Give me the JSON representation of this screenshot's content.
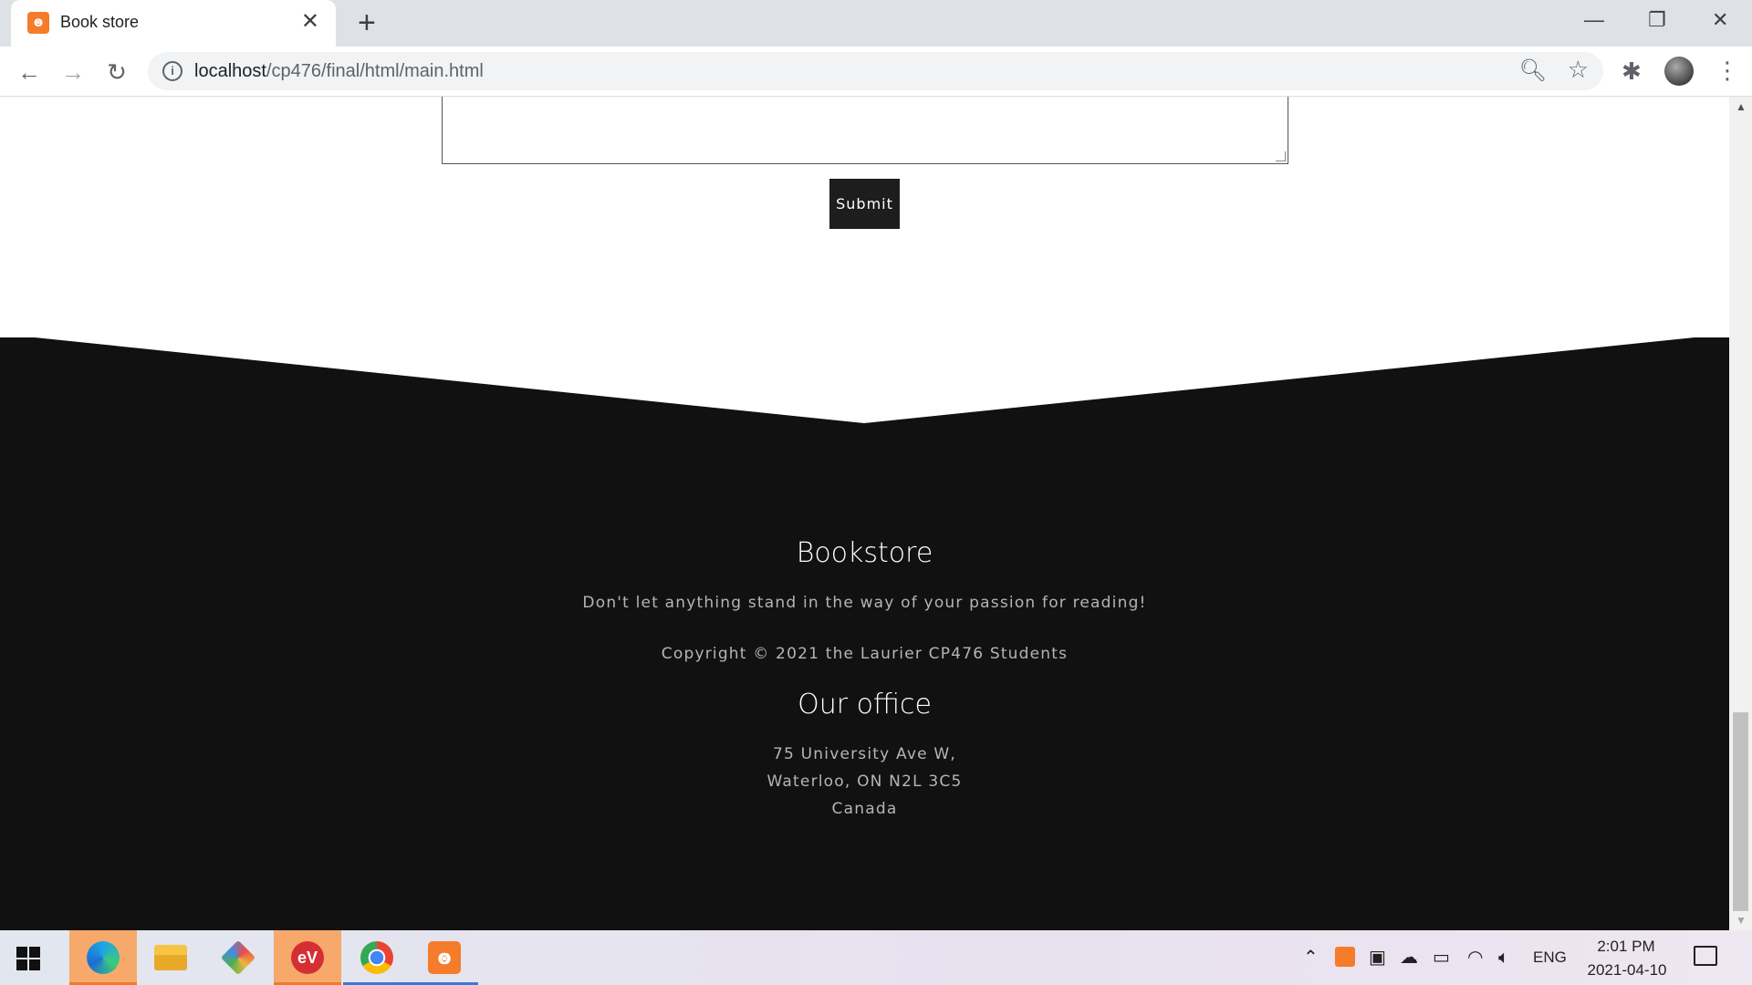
{
  "browser": {
    "tab_title": "Book store",
    "tab_close": "✕",
    "new_tab": "+",
    "url_host": "localhost",
    "url_path": "/cp476/final/html/main.html",
    "window_controls": {
      "minimize": "—",
      "restore": "❐",
      "close": "✕"
    }
  },
  "page": {
    "submit_label": "Submit",
    "footer": {
      "title": "Bookstore",
      "tagline": "Don't let anything stand in the way of your passion for reading!",
      "copyright": "Copyright © 2021 the Laurier CP476 Students",
      "office_title": "Our office",
      "address_line1": "75 University Ave W,",
      "address_line2": "Waterloo, ON N2L 3C5",
      "address_line3": "Canada"
    }
  },
  "taskbar": {
    "language": "ENG",
    "time": "2:01 PM",
    "date": "2021-04-10",
    "apps": [
      "edge",
      "file-explorer",
      "git",
      "expressvpn",
      "chrome",
      "xampp"
    ]
  },
  "colors": {
    "footer_bg": "#111111",
    "submit_bg": "#1d1d1d",
    "favicon": "#f57c2a"
  }
}
